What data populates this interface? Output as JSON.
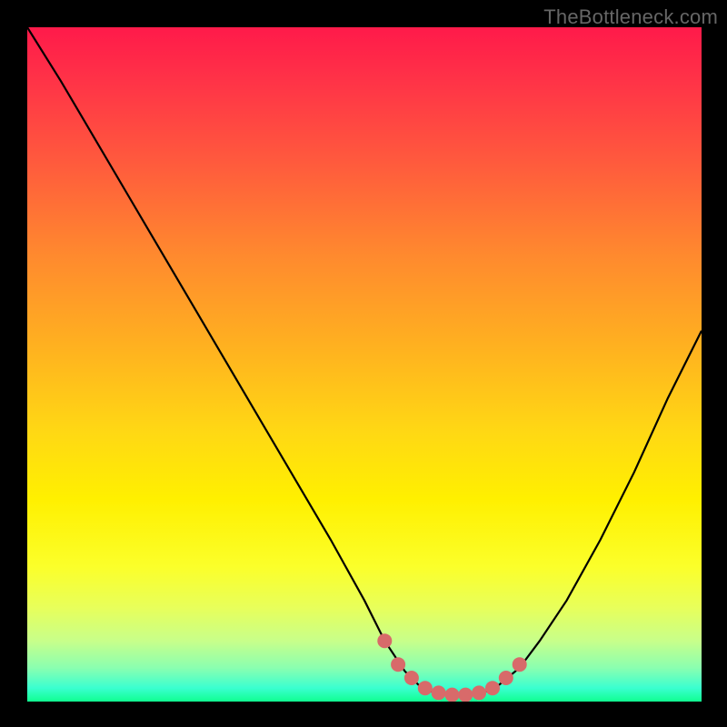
{
  "watermark": "TheBottleneck.com",
  "chart_data": {
    "type": "line",
    "title": "",
    "xlabel": "",
    "ylabel": "",
    "xlim": [
      0,
      100
    ],
    "ylim": [
      0,
      100
    ],
    "series": [
      {
        "name": "curve",
        "x": [
          0,
          5,
          10,
          15,
          20,
          25,
          30,
          35,
          40,
          45,
          50,
          53,
          56,
          58,
          60,
          62,
          64,
          66,
          68,
          70,
          73,
          76,
          80,
          85,
          90,
          95,
          100
        ],
        "y": [
          100,
          92,
          83.5,
          75,
          66.5,
          58,
          49.5,
          41,
          32.5,
          24,
          15,
          9,
          4.5,
          2.5,
          1.5,
          1,
          1,
          1,
          1.5,
          2.5,
          5,
          9,
          15,
          24,
          34,
          45,
          55
        ]
      },
      {
        "name": "highlight-dots",
        "x": [
          53,
          55,
          57,
          59,
          61,
          63,
          65,
          67,
          69,
          71,
          73
        ],
        "y": [
          9,
          5.5,
          3.5,
          2,
          1.3,
          1,
          1,
          1.3,
          2,
          3.5,
          5.5
        ]
      }
    ],
    "gradient_stops": [
      {
        "pos": 0,
        "color": "#ff1a4a"
      },
      {
        "pos": 34,
        "color": "#ff8a2e"
      },
      {
        "pos": 60,
        "color": "#ffd814"
      },
      {
        "pos": 86,
        "color": "#e8ff5a"
      },
      {
        "pos": 100,
        "color": "#10ff90"
      }
    ]
  }
}
